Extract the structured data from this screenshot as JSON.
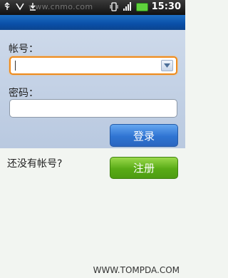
{
  "status_bar": {
    "time": "15:30",
    "watermark": "www.cnmo.com",
    "icons": [
      "usb-icon",
      "notification-icon",
      "download-icon",
      "vibrate-icon",
      "signal-icon",
      "battery-icon"
    ]
  },
  "login": {
    "account_label": "帐号：",
    "account_value": "",
    "password_label": "密码：",
    "password_value": "",
    "login_button": "登录"
  },
  "register": {
    "prompt": "还没有帐号?",
    "register_button": "注册"
  },
  "footer": {
    "watermark": "WWW.TOMPDA.COM"
  },
  "colors": {
    "title_bar": "#0a4fa8",
    "form_bg": "#c3d2e6",
    "focus_border": "#ef8b1b",
    "login_button": "#2f74d2",
    "register_button": "#59ab16"
  }
}
